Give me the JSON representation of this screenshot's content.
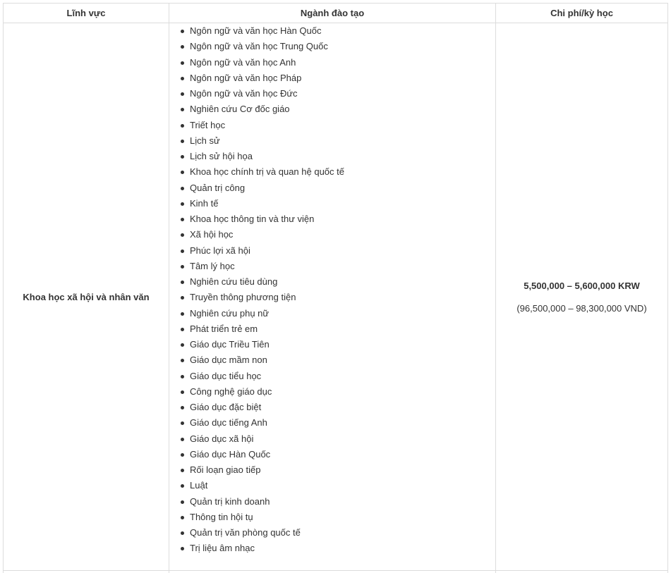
{
  "table": {
    "headers": {
      "field": "Lĩnh vực",
      "majors": "Ngành đào tạo",
      "cost": "Chi phí/kỳ học"
    },
    "rows": [
      {
        "field": "Khoa học xã hội và nhân văn",
        "majors": [
          "Ngôn ngữ và văn học Hàn Quốc",
          "Ngôn ngữ và văn học Trung Quốc",
          "Ngôn ngữ và văn học Anh",
          "Ngôn ngữ và văn học Pháp",
          "Ngôn ngữ và văn học Đức",
          "Nghiên cứu Cơ đốc giáo",
          "Triết học",
          "Lịch sử",
          "Lịch sử hội họa",
          "Khoa học chính trị và quan hệ quốc tế",
          "Quản trị công",
          "Kinh tế",
          "Khoa học thông tin và thư viện",
          "Xã hội học",
          "Phúc lợi xã hội",
          "Tâm lý học",
          "Nghiên cứu tiêu dùng",
          "Truyền thông phương tiện",
          "Nghiên cứu phụ nữ",
          "Phát triển trẻ em",
          "Giáo dục Triều Tiên",
          "Giáo dục mầm non",
          "Giáo dục tiểu học",
          "Công nghệ giáo dục",
          "Giáo dục đặc biệt",
          "Giáo dục tiếng Anh",
          "Giáo dục xã hội",
          "Giáo dục Hàn Quốc",
          "Rối loạn giao tiếp",
          "Luật",
          "Quản trị kinh doanh",
          "Thông tin hội tụ",
          "Quản trị văn phòng quốc tế",
          "Trị liệu âm nhạc"
        ],
        "cost_krw": "5,500,000 – 5,600,000 KRW",
        "cost_vnd": "(96,500,000 – 98,300,000 VND)"
      }
    ]
  }
}
